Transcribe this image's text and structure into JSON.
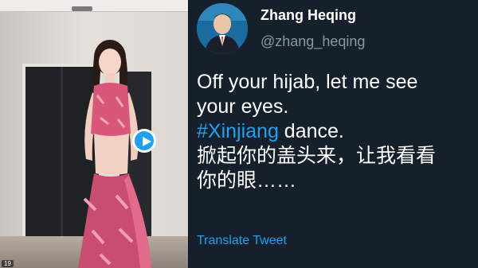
{
  "video": {
    "play_icon": "play-icon",
    "corner_tag": "19",
    "colors": {
      "play_button": "#1da1f2",
      "outfit": "#d9587a"
    }
  },
  "tweet": {
    "display_name": "Zhang Heqing",
    "handle": "@zhang_heqing",
    "lines": {
      "line1": "Off your hijab, let me see",
      "line2": "your eyes.",
      "hashtag": "#Xinjiang",
      "line3_rest": " dance.",
      "line4": "掀起你的盖头来，让我看看",
      "line5": "你的眼……"
    },
    "translate_link": "Translate Tweet"
  },
  "colors": {
    "background": "#15202b",
    "text": "#ffffff",
    "muted": "#8899a6",
    "accent": "#1da1f2"
  }
}
